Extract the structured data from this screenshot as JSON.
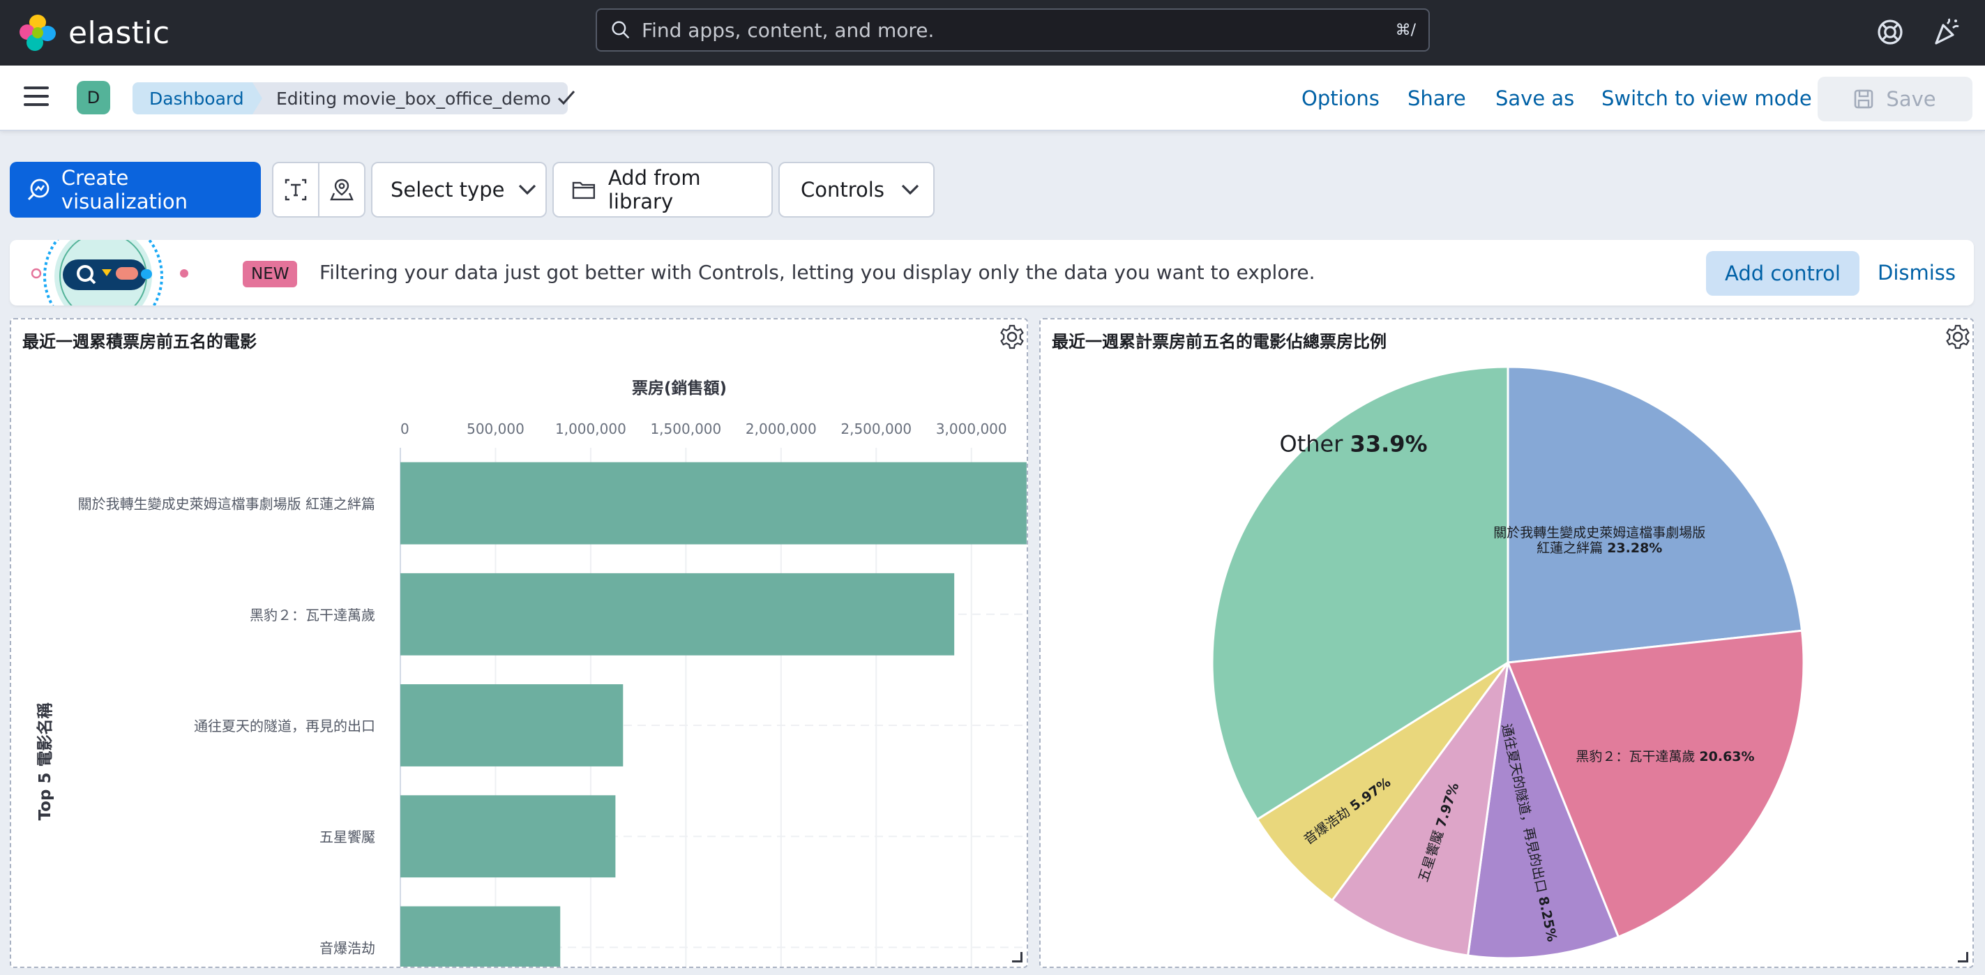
{
  "header": {
    "brand": "elastic",
    "search_placeholder": "Find apps, content, and more.",
    "search_shortcut": "⌘/"
  },
  "actionbar": {
    "avatar_letter": "D",
    "breadcrumb": [
      "Dashboard",
      "Editing movie_box_office_demo"
    ],
    "links": [
      "Options",
      "Share",
      "Save as",
      "Switch to view mode"
    ],
    "save_label": "Save"
  },
  "toolbar": {
    "create_label": "Create visualization",
    "select_type_label": "Select type",
    "add_library_label": "Add from library",
    "controls_label": "Controls"
  },
  "callout": {
    "badge": "NEW",
    "text": "Filtering your data just got better with Controls, letting you display only the data you want to explore.",
    "add_control": "Add control",
    "dismiss": "Dismiss"
  },
  "panels": {
    "bar_title": "最近一週累積票房前五名的電影",
    "pie_title": "最近一週累計票房前五名的電影佔總票房比例"
  },
  "chart_data": [
    {
      "type": "bar",
      "orientation": "horizontal",
      "xlabel": "票房(銷售額)",
      "ylabel": "Top 5 電影名稱",
      "xlim": [
        0,
        3300000
      ],
      "ticks": [
        0,
        500000,
        1000000,
        1500000,
        2000000,
        2500000,
        3000000
      ],
      "tick_labels": [
        "0",
        "500,000",
        "1,000,000",
        "1,500,000",
        "2,000,000",
        "2,500,000",
        "3,000,000"
      ],
      "categories": [
        "關於我轉生變成史萊姆這檔事劇場版 紅蓮之絆篇",
        "黑豹２：瓦干達萬歲",
        "通往夏天的隧道，再見的出口",
        "五星饗魘",
        "音爆浩劫"
      ],
      "values": [
        3290000,
        2910000,
        1170000,
        1130000,
        840000
      ],
      "color": "#6dafa0",
      "grid": true
    },
    {
      "type": "pie",
      "slices": [
        {
          "label": "關於我轉生變成史萊姆這檔事劇場版 紅蓮之絆篇",
          "value": 23.28,
          "display": "23.28%",
          "color": "#86a8d6"
        },
        {
          "label": "黑豹２：瓦干達萬歲",
          "value": 20.63,
          "display": "20.63%",
          "color": "#e17c9b"
        },
        {
          "label": "通往夏天的隧道，再見的出口",
          "value": 8.25,
          "display": "8.25%",
          "color": "#a988cf"
        },
        {
          "label": "五星饗魘",
          "value": 7.97,
          "display": "7.97%",
          "color": "#dda5c8"
        },
        {
          "label": "音爆浩劫",
          "value": 5.97,
          "display": "5.97%",
          "color": "#e9d77c"
        },
        {
          "label": "Other",
          "value": 33.9,
          "display": "33.9%",
          "color": "#88ccb1"
        }
      ]
    }
  ]
}
